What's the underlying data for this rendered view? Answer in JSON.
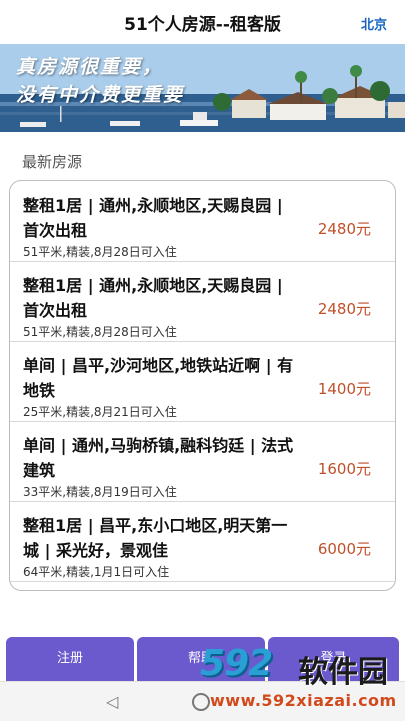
{
  "header": {
    "title": "51个人房源--租客版",
    "city": "北京"
  },
  "banner": {
    "line1": "真房源很重要，",
    "line2": "没有中介费更重要"
  },
  "section": {
    "title": "最新房源"
  },
  "listings": [
    {
      "title": "整租1居 | 通州,永顺地区,天赐良园 | 首次出租",
      "meta": "51平米,精装,8月28日可入住",
      "price": "2480元"
    },
    {
      "title": "整租1居 | 通州,永顺地区,天赐良园 | 首次出租",
      "meta": "51平米,精装,8月28日可入住",
      "price": "2480元"
    },
    {
      "title": "单间 | 昌平,沙河地区,地铁站近啊 | 有地铁",
      "meta": "25平米,精装,8月21日可入住",
      "price": "1400元"
    },
    {
      "title": "单间 | 通州,马驹桥镇,融科钧廷 | 法式建筑",
      "meta": "33平米,精装,8月19日可入住",
      "price": "1600元"
    },
    {
      "title": "整租1居 | 昌平,东小口地区,明天第一城 | 采光好，景观佳",
      "meta": "64平米,精装,1月1日可入住",
      "price": "6000元"
    }
  ],
  "tabs": {
    "register": "注册",
    "help": "帮助",
    "login": "登录"
  },
  "navbar": {
    "back_icon": "◁",
    "home_icon": "circle"
  },
  "watermark": {
    "logo": "592",
    "text": "软件园",
    "url": "www.592xiazai.com"
  },
  "colors": {
    "accent": "#1565c0",
    "price": "#c0502b",
    "tab": "#6a5acd"
  }
}
